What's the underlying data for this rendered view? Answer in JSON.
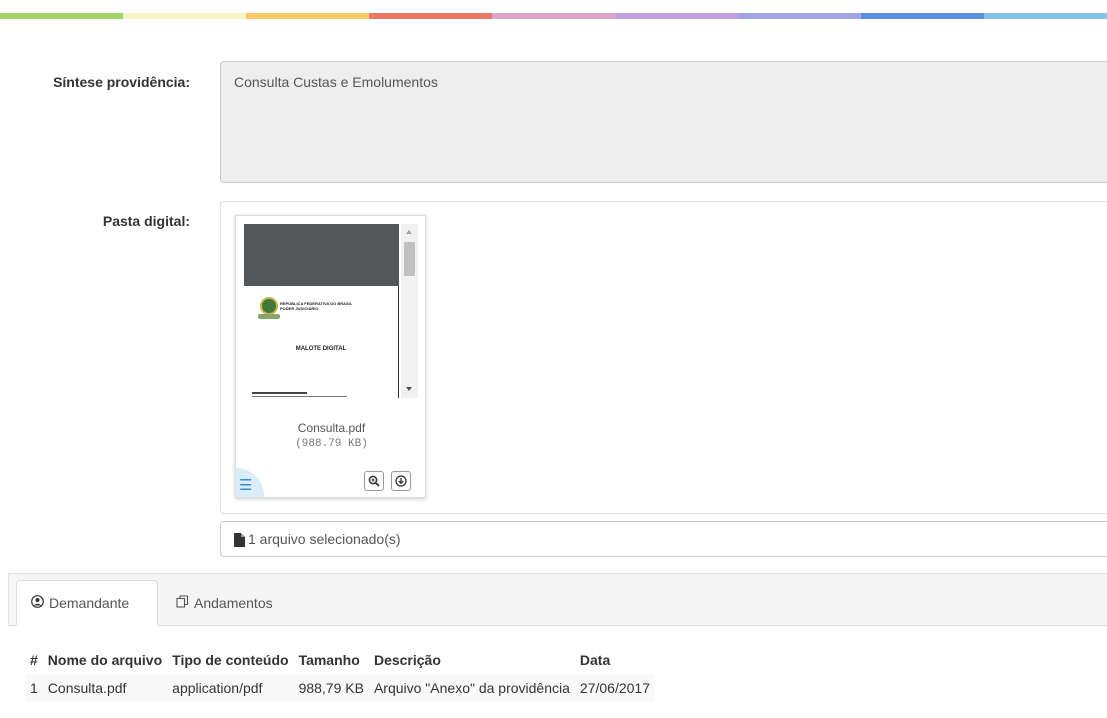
{
  "colors": {
    "accent_bar": [
      "#a4d26a",
      "#f5f5c5",
      "#f7c96a",
      "#ef7566",
      "#dba3c8",
      "#c39ee0",
      "#a3a4e6",
      "#5b8fd9",
      "#7fc5e8"
    ]
  },
  "form": {
    "sintese_label": "Síntese providência:",
    "sintese_value": "Consulta Custas e Emolumentos",
    "pasta_label": "Pasta digital:"
  },
  "file_card": {
    "preview": {
      "header_line1": "REPÚBLICA FEDERATIVA DO BRASIL",
      "header_line2": "PODER JUDICIÁRIO",
      "title": "MALOTE DIGITAL"
    },
    "filename": "Consulta.pdf",
    "size": "(988.79 KB)",
    "icons": {
      "menu": "menu-icon",
      "zoom": "zoom-in-icon",
      "download": "download-icon"
    }
  },
  "selection": {
    "text": "1 arquivo selecionado(s)"
  },
  "tabs": [
    {
      "label": "Demandante",
      "icon": "user-circle-icon",
      "active": true
    },
    {
      "label": "Andamentos",
      "icon": "copy-icon",
      "active": false
    }
  ],
  "table": {
    "headers": [
      "#",
      "Nome do arquivo",
      "Tipo de conteúdo",
      "Tamanho",
      "Descrição",
      "Data"
    ],
    "rows": [
      [
        "1",
        "Consulta.pdf",
        "application/pdf",
        "988,79 KB",
        "Arquivo \"Anexo\" da providência",
        "27/06/2017"
      ]
    ]
  }
}
